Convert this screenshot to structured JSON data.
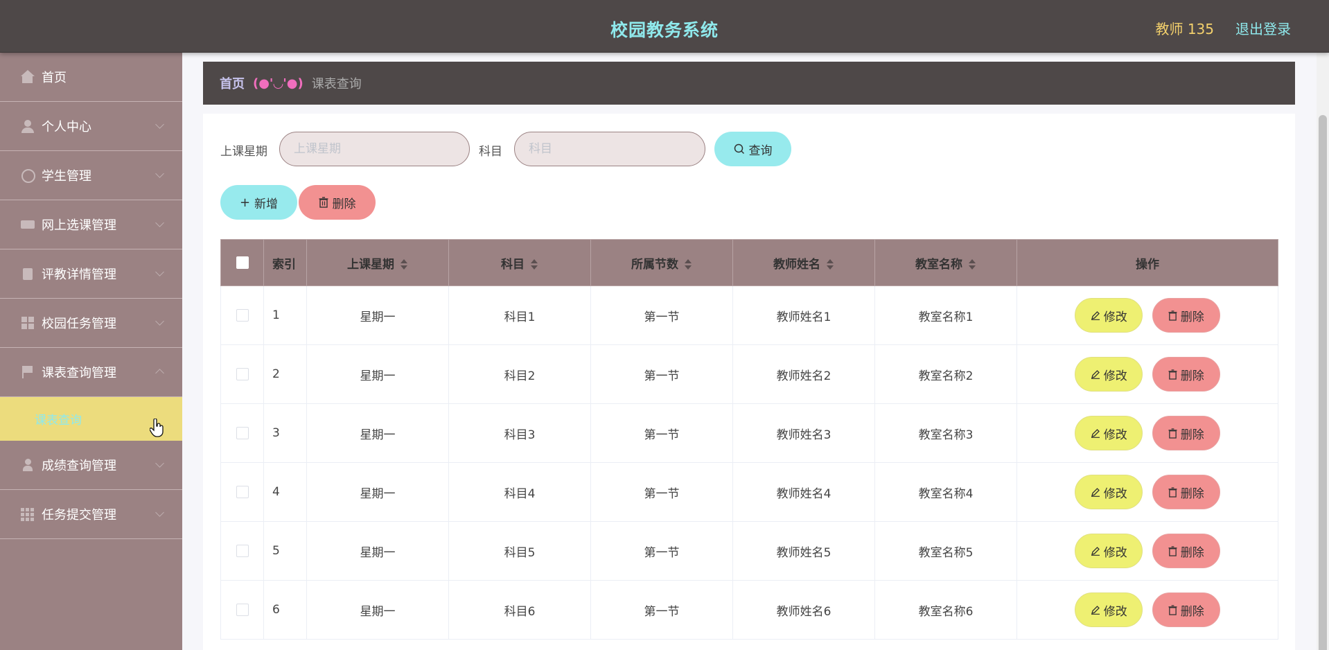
{
  "header": {
    "title": "校园教务系统",
    "user": "教师 135",
    "logout": "退出登录"
  },
  "sidebar": {
    "items": [
      {
        "label": "首页",
        "icon": "home-icon"
      },
      {
        "label": "个人中心",
        "icon": "user-icon"
      },
      {
        "label": "学生管理",
        "icon": "compass-icon"
      },
      {
        "label": "网上选课管理",
        "icon": "card-icon"
      },
      {
        "label": "评教详情管理",
        "icon": "clipboard-icon"
      },
      {
        "label": "校园任务管理",
        "icon": "grid-icon"
      },
      {
        "label": "课表查询管理",
        "icon": "flag-icon"
      },
      {
        "label": "成绩查询管理",
        "icon": "person-icon"
      },
      {
        "label": "任务提交管理",
        "icon": "apps-icon"
      }
    ],
    "active_sub": "课表查询"
  },
  "breadcrumb": {
    "home": "首页",
    "separator": "(●'◡'●)",
    "current": "课表查询"
  },
  "search": {
    "weekday_label": "上课星期",
    "weekday_placeholder": "上课星期",
    "subject_label": "科目",
    "subject_placeholder": "科目",
    "query_button": "查询"
  },
  "actions": {
    "add": "新增",
    "delete": "删除"
  },
  "table": {
    "columns": [
      "索引",
      "上课星期",
      "科目",
      "所属节数",
      "教师姓名",
      "教室名称",
      "操作"
    ],
    "rows": [
      {
        "index": "1",
        "weekday": "星期一",
        "subject": "科目1",
        "section": "第一节",
        "teacher": "教师姓名1",
        "classroom": "教室名称1"
      },
      {
        "index": "2",
        "weekday": "星期一",
        "subject": "科目2",
        "section": "第一节",
        "teacher": "教师姓名2",
        "classroom": "教室名称2"
      },
      {
        "index": "3",
        "weekday": "星期一",
        "subject": "科目3",
        "section": "第一节",
        "teacher": "教师姓名3",
        "classroom": "教室名称3"
      },
      {
        "index": "4",
        "weekday": "星期一",
        "subject": "科目4",
        "section": "第一节",
        "teacher": "教师姓名4",
        "classroom": "教室名称4"
      },
      {
        "index": "5",
        "weekday": "星期一",
        "subject": "科目5",
        "section": "第一节",
        "teacher": "教师姓名5",
        "classroom": "教室名称5"
      },
      {
        "index": "6",
        "weekday": "星期一",
        "subject": "科目6",
        "section": "第一节",
        "teacher": "教师姓名6",
        "classroom": "教室名称6"
      }
    ],
    "edit_label": "修改",
    "delete_label": "删除"
  },
  "colors": {
    "header_bg": "#4e4848",
    "sidebar_bg": "#9b8283",
    "accent_cyan": "#97eaed",
    "accent_yellow": "#eef072",
    "accent_red": "#f29191",
    "active_sub_bg": "#ecdc7d"
  }
}
